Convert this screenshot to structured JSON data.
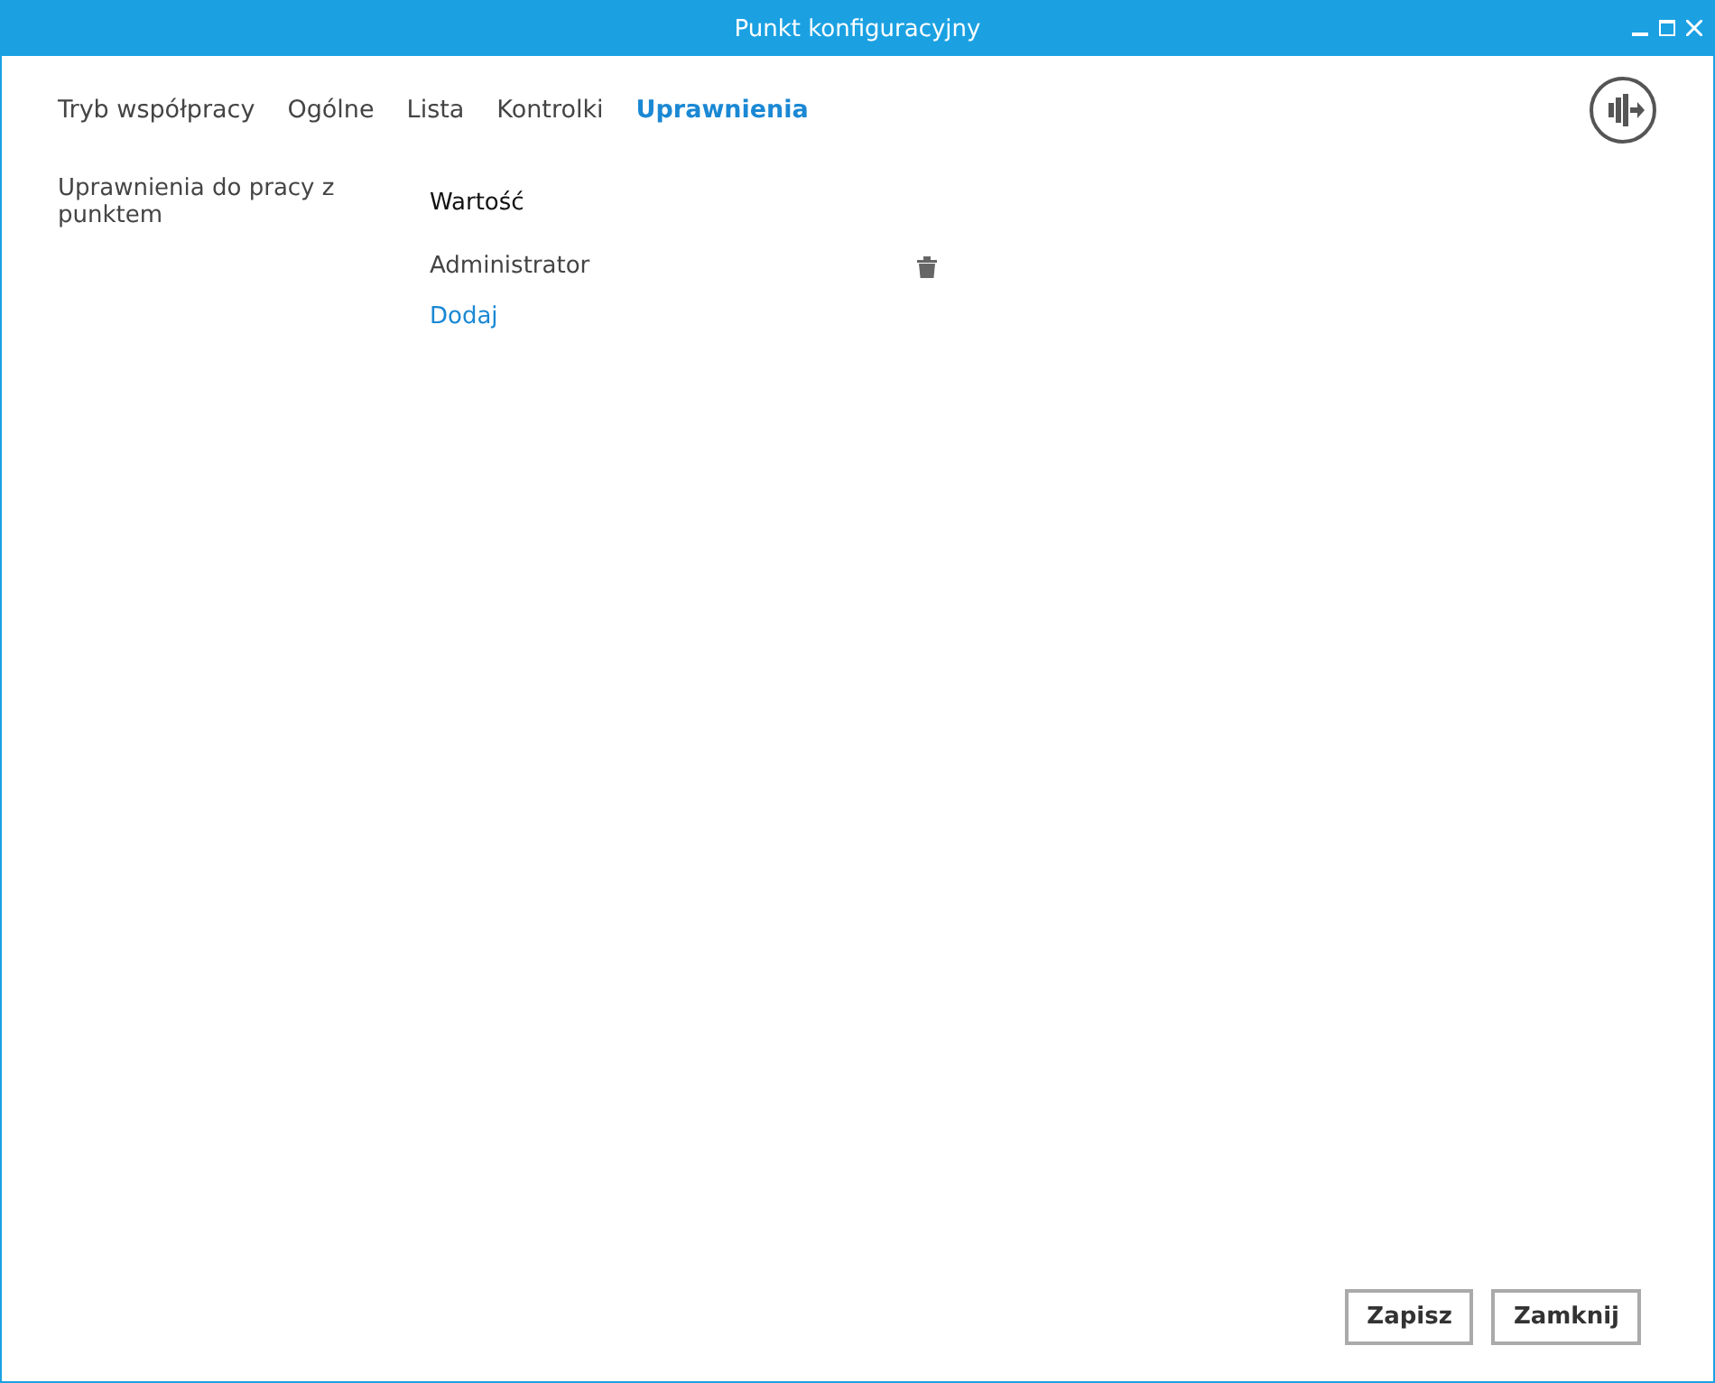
{
  "window": {
    "title": "Punkt konfiguracyjny"
  },
  "tabs": [
    {
      "label": "Tryb współpracy",
      "selected": false
    },
    {
      "label": "Ogólne",
      "selected": false
    },
    {
      "label": "Lista",
      "selected": false
    },
    {
      "label": "Kontrolki",
      "selected": false
    },
    {
      "label": "Uprawnienia",
      "selected": true
    }
  ],
  "permissions": {
    "label": "Uprawnienia do pracy z punktem",
    "column": "Wartość",
    "rows": [
      {
        "value": "Administrator"
      }
    ],
    "add_link": "Dodaj"
  },
  "buttons": [
    "Zapisz",
    "Zamknij"
  ]
}
